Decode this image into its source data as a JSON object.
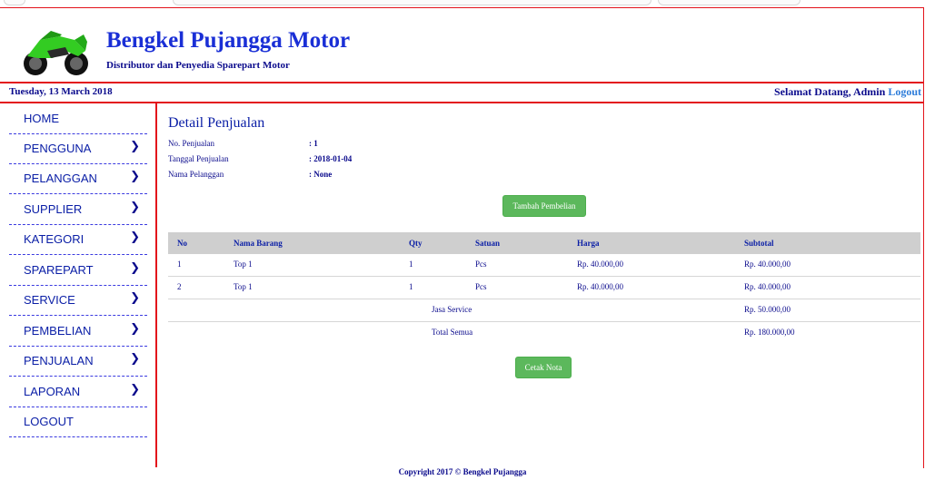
{
  "colors": {
    "accent_red": "#e3131b",
    "brand_blue": "#1a2fd6",
    "text_navy": "#0a0a8c",
    "button_green": "#5cb85c",
    "table_header_gray": "#cfcfcf"
  },
  "header": {
    "title": "Bengkel Pujangga Motor",
    "subtitle": "Distributor dan Penyedia Sparepart Motor",
    "logo_icon": "motorcycle-icon"
  },
  "topbar": {
    "date": "Tuesday, 13 March 2018",
    "welcome": "Selamat Datang, Admin",
    "logout": "Logout"
  },
  "sidebar": {
    "items": [
      {
        "label": "HOME",
        "has_submenu": false
      },
      {
        "label": "PENGGUNA",
        "has_submenu": true
      },
      {
        "label": "PELANGGAN",
        "has_submenu": true
      },
      {
        "label": "SUPPLIER",
        "has_submenu": true
      },
      {
        "label": "KATEGORI",
        "has_submenu": true
      },
      {
        "label": "SPAREPART",
        "has_submenu": true
      },
      {
        "label": "SERVICE",
        "has_submenu": true
      },
      {
        "label": "PEMBELIAN",
        "has_submenu": true
      },
      {
        "label": "PENJUALAN",
        "has_submenu": true
      },
      {
        "label": "LAPORAN",
        "has_submenu": true
      },
      {
        "label": "LOGOUT",
        "has_submenu": false
      }
    ],
    "chevron_glyph": "❯"
  },
  "main": {
    "title": "Detail Penjualan",
    "info": [
      {
        "label": "No. Penjualan",
        "value": ": 1"
      },
      {
        "label": "Tanggal Penjualan",
        "value": ": 2018-01-04"
      },
      {
        "label": "Nama Pelanggan",
        "value": ": None"
      }
    ],
    "add_button": "Tambah Pembelian",
    "table": {
      "headers": [
        "No",
        "Nama Barang",
        "Qty",
        "Satuan",
        "Harga",
        "Subtotal"
      ],
      "rows": [
        [
          "1",
          "Top 1",
          "1",
          "Pcs",
          "Rp. 40.000,00",
          "Rp. 40.000,00"
        ],
        [
          "2",
          "Top 1",
          "1",
          "Pcs",
          "Rp. 40.000,00",
          "Rp. 40.000,00"
        ]
      ],
      "service_label": "Jasa Service",
      "service_value": "Rp. 50.000,00",
      "total_label": "Total Semua",
      "total_value": "Rp. 180.000,00"
    },
    "print_button": "Cetak Nota"
  },
  "footer": {
    "copyright": "Copyright 2017 © Bengkel Pujangga"
  }
}
